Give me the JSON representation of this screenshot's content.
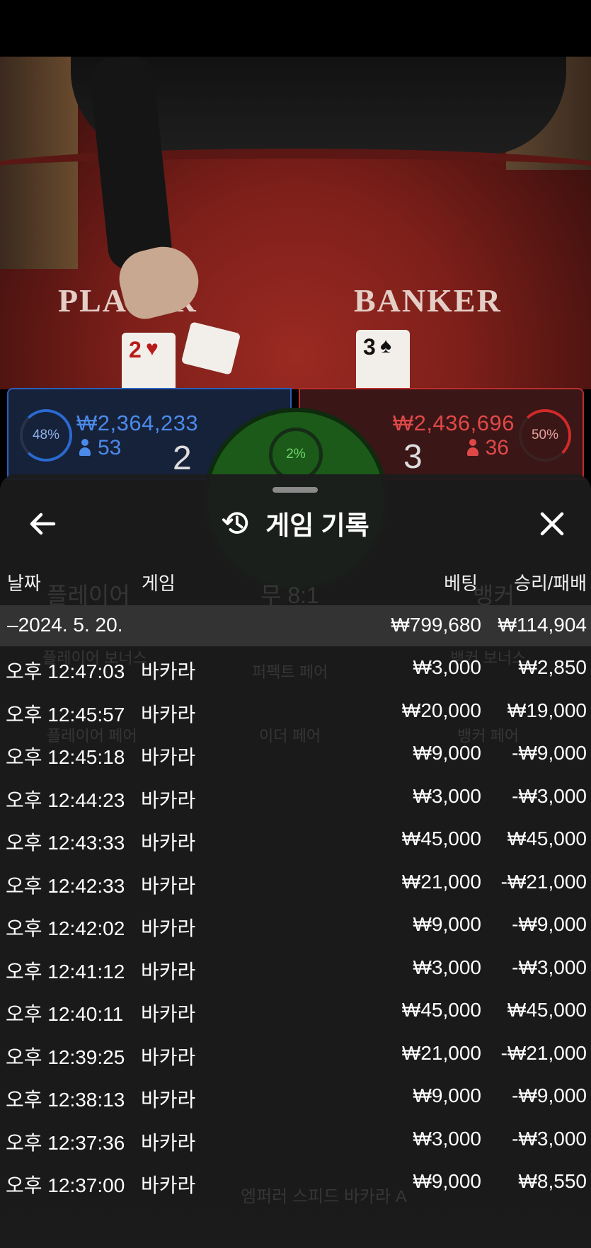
{
  "video": {
    "player_label": "PLAYER",
    "banker_label": "BANKER",
    "cards": [
      {
        "rank": "2",
        "suit": "♥"
      },
      {
        "rank": "3",
        "suit": "♠"
      }
    ]
  },
  "stats": {
    "player": {
      "percent": "48%",
      "amount": "₩2,364,233",
      "players": "53",
      "score": "2"
    },
    "banker": {
      "percent": "50%",
      "amount": "₩2,436,696",
      "players": "36",
      "score": "3"
    },
    "tie": {
      "percent": "2%"
    }
  },
  "colors": {
    "player_blue": "#2e5fb8",
    "banker_red": "#b82e2e",
    "tie_green": "#1c5a1a",
    "sheet_bg": "#1c1c1c"
  },
  "modal": {
    "title": "게임 기록",
    "icons": {
      "back": "arrow-left-icon",
      "history": "history-clock-icon",
      "close": "close-icon"
    },
    "headers": {
      "date": "날짜",
      "game": "게임",
      "bet": "베팅",
      "result": "승리/패배"
    },
    "date_group": {
      "date": "–2024. 5. 20.",
      "bet_total": "₩799,680",
      "result_total": "₩114,904"
    },
    "rows": [
      {
        "time": "오후 12:47:03",
        "game": "바카라",
        "bet": "₩3,000",
        "result": "₩2,850"
      },
      {
        "time": "오후 12:45:57",
        "game": "바카라",
        "bet": "₩20,000",
        "result": "₩19,000"
      },
      {
        "time": "오후 12:45:18",
        "game": "바카라",
        "bet": "₩9,000",
        "result": "-₩9,000"
      },
      {
        "time": "오후 12:44:23",
        "game": "바카라",
        "bet": "₩3,000",
        "result": "-₩3,000"
      },
      {
        "time": "오후 12:43:33",
        "game": "바카라",
        "bet": "₩45,000",
        "result": "₩45,000"
      },
      {
        "time": "오후 12:42:33",
        "game": "바카라",
        "bet": "₩21,000",
        "result": "-₩21,000"
      },
      {
        "time": "오후 12:42:02",
        "game": "바카라",
        "bet": "₩9,000",
        "result": "-₩9,000"
      },
      {
        "time": "오후 12:41:12",
        "game": "바카라",
        "bet": "₩3,000",
        "result": "-₩3,000"
      },
      {
        "time": "오후 12:40:11",
        "game": "바카라",
        "bet": "₩45,000",
        "result": "₩45,000"
      },
      {
        "time": "오후 12:39:25",
        "game": "바카라",
        "bet": "₩21,000",
        "result": "-₩21,000"
      },
      {
        "time": "오후 12:38:13",
        "game": "바카라",
        "bet": "₩9,000",
        "result": "-₩9,000"
      },
      {
        "time": "오후 12:37:36",
        "game": "바카라",
        "bet": "₩3,000",
        "result": "-₩3,000"
      },
      {
        "time": "오후 12:37:00",
        "game": "바카라",
        "bet": "₩9,000",
        "result": "₩8,550"
      }
    ]
  },
  "background_ui": {
    "tie_payout": "무 8:1",
    "player_bet": "플레이어",
    "banker_bet": "뱅커",
    "player_bonus": "플레이어 보너스",
    "perfect_pair": "퍼펙트 페어",
    "either_pair": "이더 페어",
    "player_pair": "플레이어 페어",
    "banker_bonus": "뱅커 보너스",
    "banker_pair": "뱅커 페어",
    "footer_game": "엠퍼러 스피드 바카라 A"
  }
}
